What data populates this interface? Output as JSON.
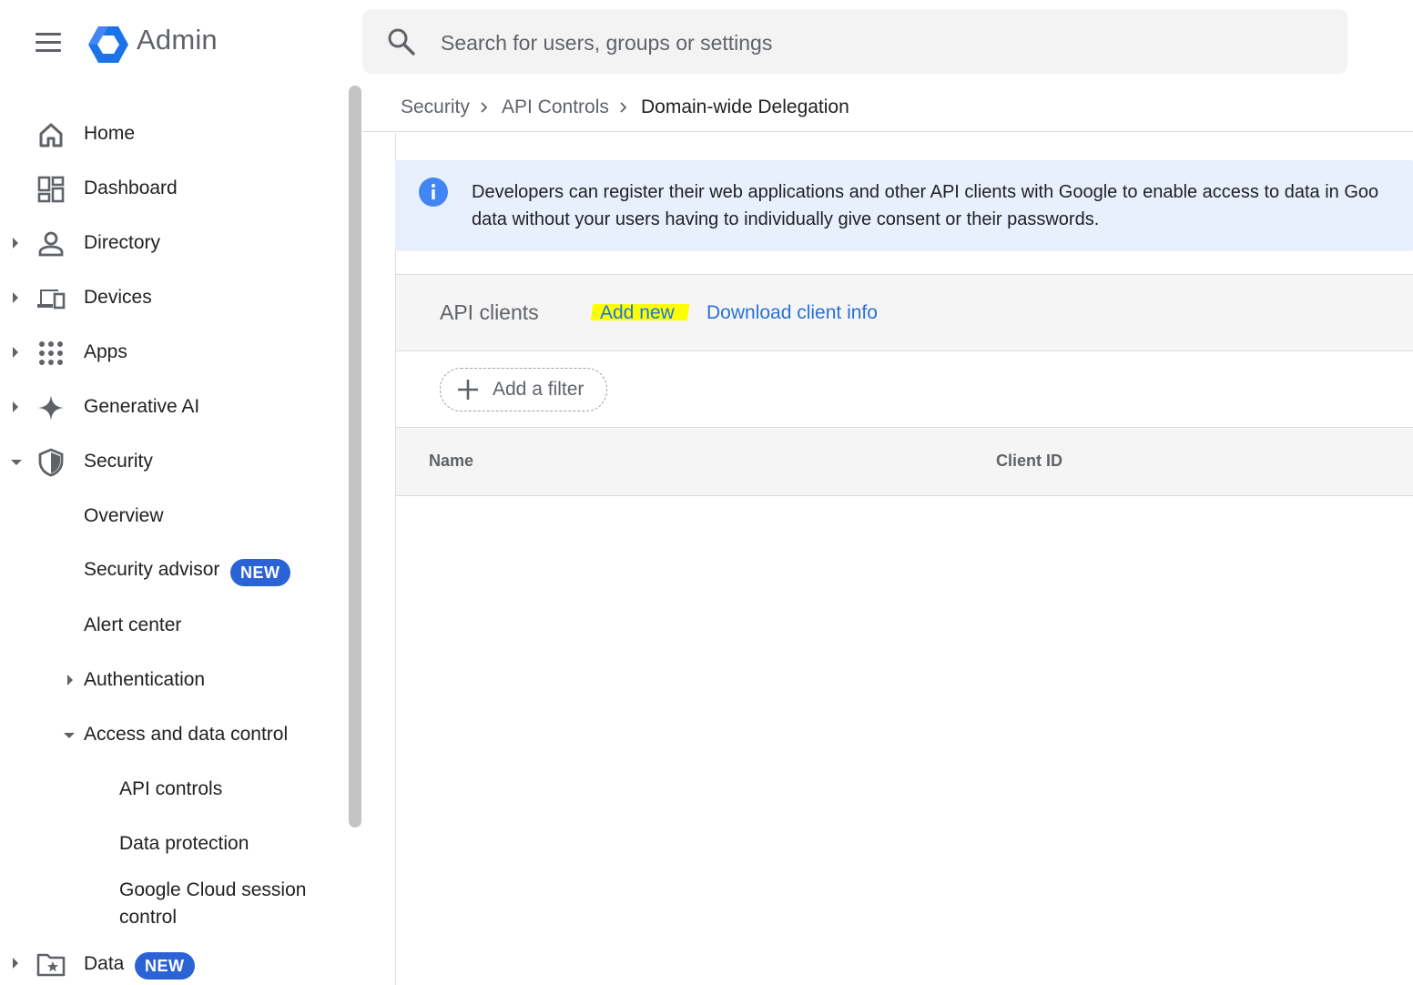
{
  "header": {
    "app_title": "Admin",
    "search_placeholder": "Search for users, groups or settings"
  },
  "sidebar": {
    "items": [
      {
        "label": "Home",
        "icon": "home-icon",
        "expand": "none"
      },
      {
        "label": "Dashboard",
        "icon": "dashboard-icon",
        "expand": "collapsed"
      },
      {
        "label": "Directory",
        "icon": "person-icon",
        "expand": "collapsed"
      },
      {
        "label": "Devices",
        "icon": "devices-icon",
        "expand": "collapsed"
      },
      {
        "label": "Apps",
        "icon": "apps-grid-icon",
        "expand": "collapsed"
      },
      {
        "label": "Generative AI",
        "icon": "sparkle-icon",
        "expand": "collapsed"
      },
      {
        "label": "Security",
        "icon": "shield-icon",
        "expand": "expanded"
      },
      {
        "label": "Data",
        "icon": "folder-star-icon",
        "expand": "collapsed",
        "badge": "NEW"
      }
    ],
    "security_children": {
      "overview": "Overview",
      "security_advisor": "Security advisor",
      "security_advisor_badge": "NEW",
      "alert_center": "Alert center",
      "authentication": "Authentication",
      "access_and_data_control": "Access and data control",
      "api_controls": "API controls",
      "data_protection": "Data protection",
      "google_cloud_session_line1": "Google Cloud session",
      "google_cloud_session_line2": "control"
    }
  },
  "breadcrumb": {
    "items": [
      "Security",
      "API Controls",
      "Domain-wide Delegation"
    ]
  },
  "info_banner": {
    "line1": "Developers can register their web applications and other API clients with Google to enable access to data in Goo",
    "line2": "data without your users having to individually give consent or their passwords."
  },
  "api_clients": {
    "title": "API clients",
    "add_new": "Add new",
    "download": "Download client info",
    "filter": "Add a filter",
    "columns": [
      "Name",
      "Client ID"
    ],
    "rows": []
  },
  "colors": {
    "accent": "#1a73e8",
    "badge": "#2b63d6",
    "highlight": "#ffff00",
    "banner_bg": "#e8f0fe"
  }
}
